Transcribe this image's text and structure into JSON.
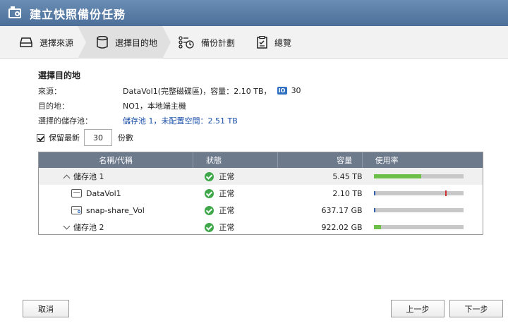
{
  "window": {
    "title": "建立快照備份任務",
    "icon": "snapshot-backup-icon"
  },
  "steps": [
    {
      "label": "選擇來源",
      "icon": "drive-icon"
    },
    {
      "label": "選擇目的地",
      "icon": "database-icon",
      "active": true
    },
    {
      "label": "備份計劃",
      "icon": "schedule-icon"
    },
    {
      "label": "總覽",
      "icon": "clipboard-icon"
    }
  ],
  "section": {
    "title": "選擇目的地"
  },
  "info": {
    "source_label": "來源：",
    "source_value": "DataVol1(完整磁碟區)，容量：2.10 TB，",
    "source_snapshot_count": "30",
    "dest_label": "目的地：",
    "dest_value": "NO1，本地端主機",
    "pool_label": "選擇的儲存池：",
    "pool_value": "儲存池 1，未配置空間：2.51 TB"
  },
  "keep": {
    "label": "保留最新",
    "value": "30",
    "unit": "份數",
    "checked": true
  },
  "table": {
    "headers": [
      "名稱/代稱",
      "狀態",
      "容量",
      "使用率"
    ],
    "rows": [
      {
        "name": "儲存池 1",
        "type": "pool",
        "expanded": true,
        "status": "正常",
        "capacity": "5.45 TB",
        "usage": 0.53,
        "usage_color": "#6cc04a"
      },
      {
        "name": "DataVol1",
        "type": "volume",
        "status": "正常",
        "capacity": "2.10 TB",
        "usage": 0.02,
        "usage_color": "#2f5fb0",
        "threshold": 0.8
      },
      {
        "name": "snap-share_Vol",
        "type": "volume",
        "status": "正常",
        "capacity": "637.17 GB",
        "usage": 0.01,
        "usage_color": "#2f5fb0"
      },
      {
        "name": "儲存池 2",
        "type": "pool",
        "expanded": false,
        "status": "正常",
        "capacity": "922.02 GB",
        "usage": 0.08,
        "usage_color": "#6cc04a"
      }
    ]
  },
  "buttons": {
    "cancel": "取消",
    "back": "上一步",
    "next": "下一步"
  },
  "colors": {
    "titlebar": "#5a7fa8",
    "header": "#6d7a8c",
    "ok": "#3fa84a",
    "link": "#1b4fa8"
  }
}
